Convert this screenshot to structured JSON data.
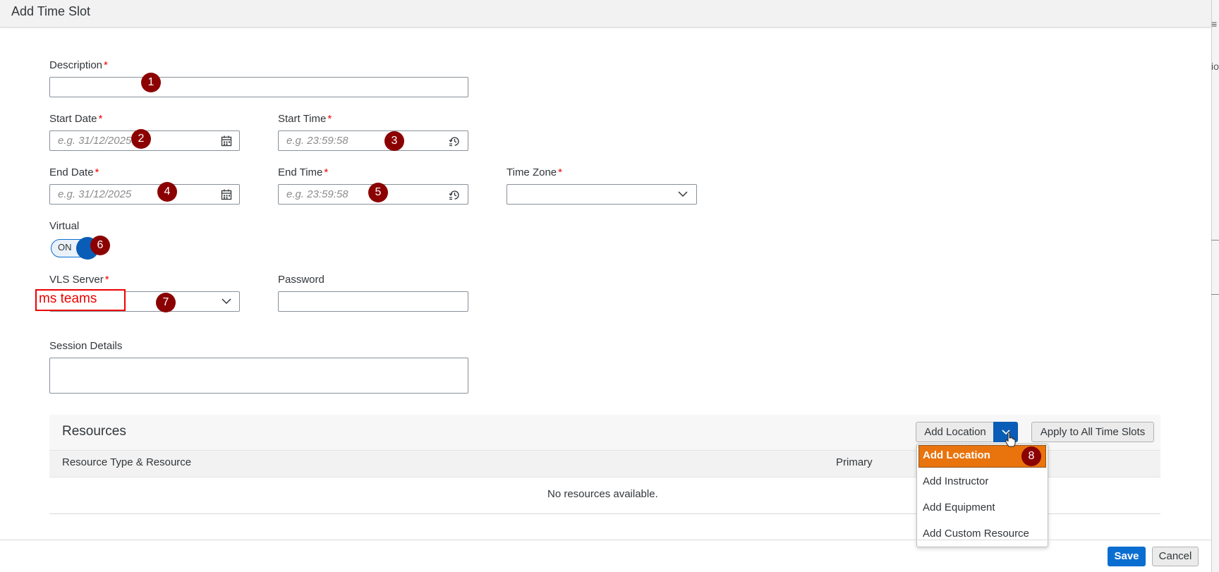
{
  "dialog": {
    "title": "Add Time Slot"
  },
  "edge_glyphs": {
    "top": "≡",
    "mid": "io"
  },
  "form": {
    "required_mark": "*",
    "description": {
      "label": "Description",
      "value": ""
    },
    "start_date": {
      "label": "Start Date",
      "placeholder": "e.g. 31/12/2025"
    },
    "start_time": {
      "label": "Start Time",
      "placeholder": "e.g. 23:59:58"
    },
    "end_date": {
      "label": "End Date",
      "placeholder": "e.g. 31/12/2025"
    },
    "end_time": {
      "label": "End Time",
      "placeholder": "e.g. 23:59:58"
    },
    "time_zone": {
      "label": "Time Zone",
      "value": ""
    },
    "virtual": {
      "label": "Virtual",
      "toggle_text": "ON",
      "checked": true
    },
    "vls_server": {
      "label": "VLS Server",
      "value": "ms teams"
    },
    "password": {
      "label": "Password",
      "value": ""
    },
    "session_details": {
      "label": "Session Details",
      "value": ""
    }
  },
  "markers": [
    "1",
    "2",
    "3",
    "4",
    "5",
    "6",
    "7",
    "8"
  ],
  "resources": {
    "title": "Resources",
    "columns": [
      "Resource Type & Resource",
      "Primary"
    ],
    "empty_text": "No resources available.",
    "add_button_label": "Add Location",
    "apply_button_label": "Apply to All Time Slots",
    "menu_items": [
      "Add Location",
      "Add Instructor",
      "Add Equipment",
      "Add Custom Resource"
    ]
  },
  "footer": {
    "save_label": "Save",
    "cancel_label": "Cancel"
  },
  "icons": {
    "calendar": "calendar-icon",
    "clock": "clock-icon",
    "chevron": "chevron-down-icon"
  },
  "colors": {
    "accent": "#0a6ed1",
    "menu_highlight": "#e9730c",
    "marker": "#8b0000",
    "required": "#ee0000"
  }
}
